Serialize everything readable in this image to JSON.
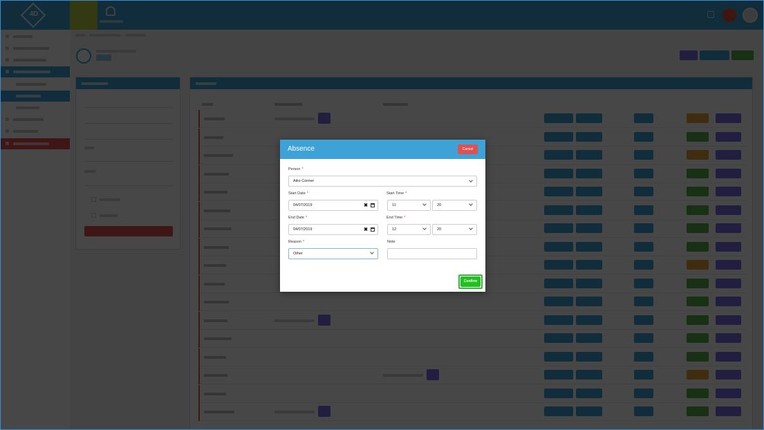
{
  "modal": {
    "title": "Absence",
    "cancel_label": "Cancel",
    "confirm_label": "Confirm",
    "person": {
      "label": "Person",
      "required": "*",
      "value": "Aiko Conner"
    },
    "start_date": {
      "label": "Start Date",
      "required": "*",
      "value": "04/07/2019"
    },
    "start_time": {
      "label": "Start Time",
      "required": "*",
      "hour": "11",
      "minute": "20"
    },
    "end_date": {
      "label": "End Date",
      "required": "*",
      "value": "04/07/2019"
    },
    "end_time": {
      "label": "End Time",
      "required": "*",
      "hour": "12",
      "minute": "20"
    },
    "reason": {
      "label": "Reason",
      "required": "*",
      "value": "Other"
    },
    "note": {
      "label": "Note",
      "value": ""
    }
  },
  "colors": {
    "accent": "#3fa2d6",
    "danger": "#e05050",
    "confirm": "#1fc21f",
    "purple": "#7b6be0",
    "green": "#56b04a",
    "orange": "#e6a23c"
  },
  "icons": [
    "logo-icon",
    "bell-icon",
    "notification-badge",
    "avatar",
    "camera-icon",
    "clear-icon",
    "calendar-icon",
    "chevron-down-icon"
  ]
}
